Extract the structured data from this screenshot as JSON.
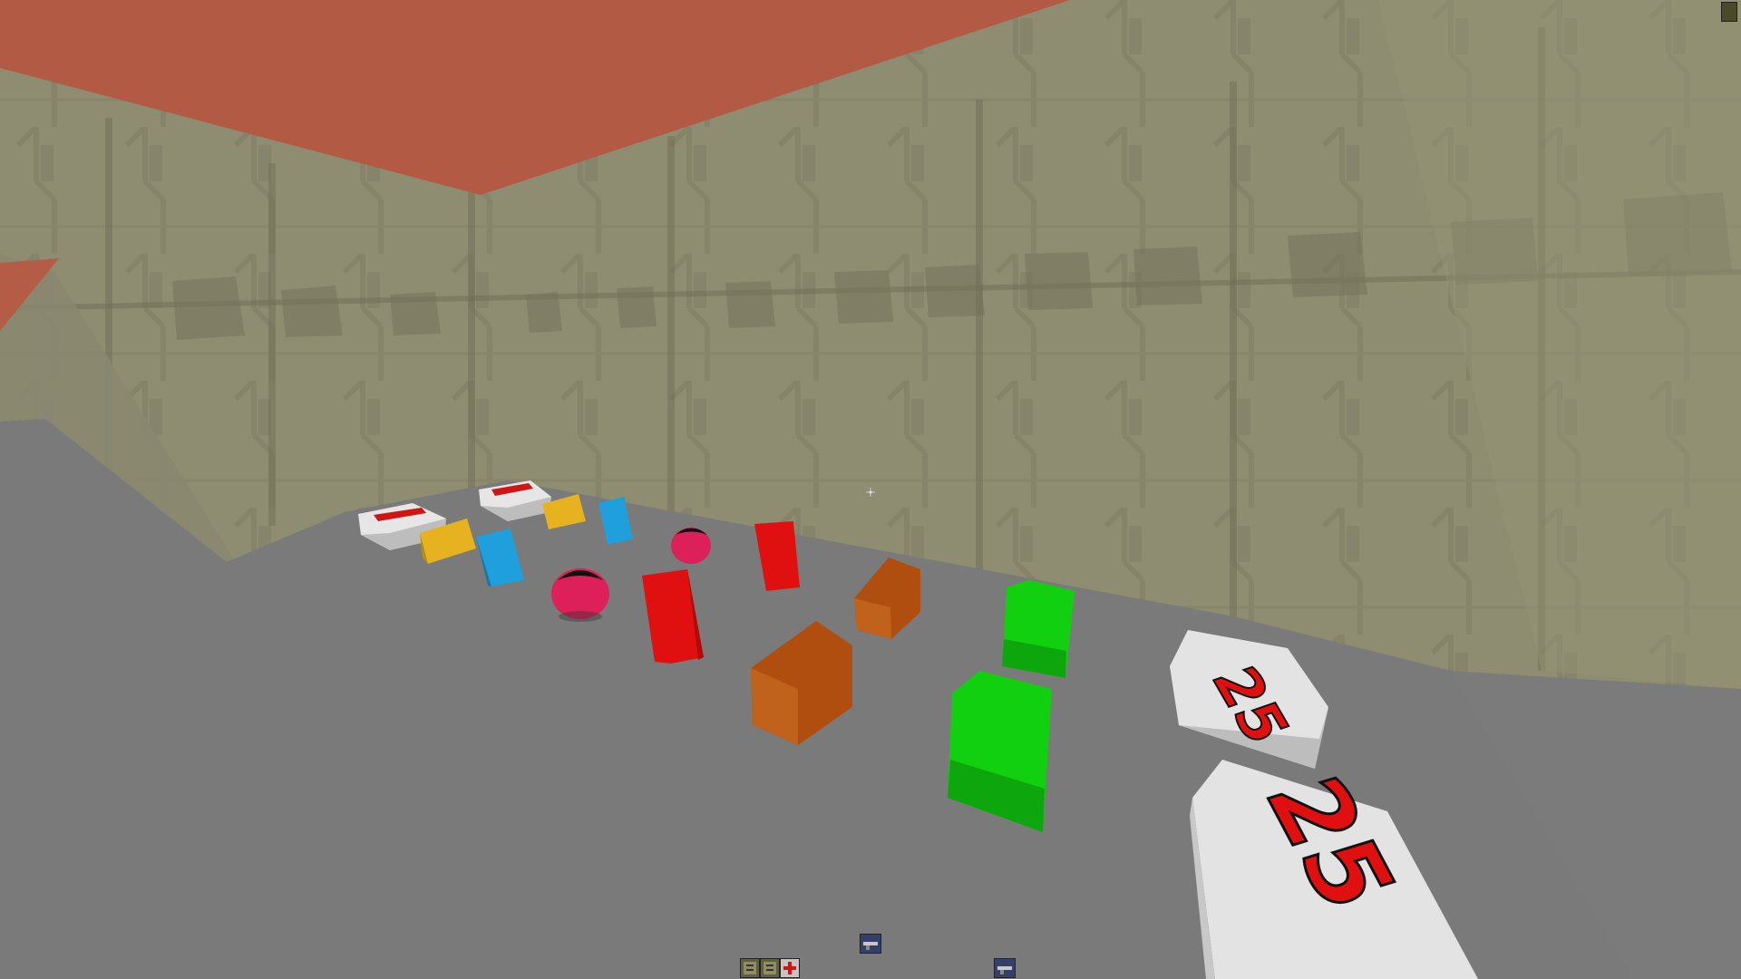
{
  "game": {
    "view": "first-person",
    "environment": {
      "ceiling": "terracotta-ceiling",
      "walls": "olive-paneled-wall",
      "floor": "gray-floor"
    },
    "crosshair": "dot-crosshair",
    "pickups": [
      {
        "kind": "white-ammo-box",
        "count": 2
      },
      {
        "kind": "yellow-block",
        "count": 2
      },
      {
        "kind": "blue-block",
        "count": 2
      },
      {
        "kind": "pink-sphere",
        "count": 2
      },
      {
        "kind": "red-cylinder",
        "count": 2
      },
      {
        "kind": "orange-block",
        "count": 2
      },
      {
        "kind": "green-block",
        "count": 2
      },
      {
        "kind": "armor-box",
        "count": 2
      }
    ],
    "armor_label": "25",
    "hud": {
      "icons": [
        "ammo-icon",
        "ammo-icon",
        "medkit-icon",
        "weapon-icon",
        "weapon-icon"
      ],
      "corner_icon": "status-icon"
    }
  },
  "colors": {
    "ceiling": "#b25a44",
    "wall": "#8e8c71",
    "floor": "#7a7a7a",
    "red": "#e01010",
    "green": "#10d010",
    "orange": "#b04e10",
    "yellow": "#e6b21f",
    "blue": "#1f9fdb",
    "pink": "#dd1f5a"
  }
}
